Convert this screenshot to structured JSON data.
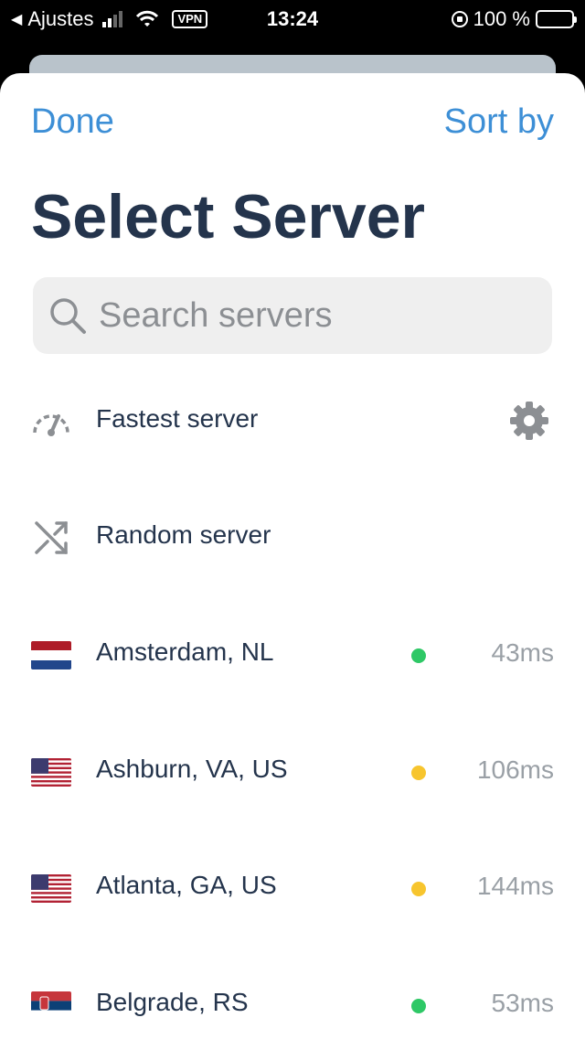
{
  "status_bar": {
    "back_label": "Ajustes",
    "vpn_badge": "VPN",
    "time": "13:24",
    "battery": "100 %"
  },
  "nav": {
    "done_label": "Done",
    "sort_label": "Sort by"
  },
  "title": "Select Server",
  "search": {
    "value": "",
    "placeholder": "Search servers"
  },
  "options": [
    {
      "label": "Fastest server",
      "icon": "speedometer-icon"
    },
    {
      "label": "Random server",
      "icon": "shuffle-icon"
    }
  ],
  "servers": [
    {
      "name": "Amsterdam, NL",
      "latency": "43ms",
      "flag": "NL",
      "status_color": "#2ec866"
    },
    {
      "name": "Ashburn, VA, US",
      "latency": "106ms",
      "flag": "US",
      "status_color": "#f7c52e"
    },
    {
      "name": "Atlanta, GA, US",
      "latency": "144ms",
      "flag": "US",
      "status_color": "#f7c52e"
    },
    {
      "name": "Belgrade, RS",
      "latency": "53ms",
      "flag": "RS",
      "status_color": "#2ec866"
    }
  ],
  "colors": {
    "accent": "#3d8fd6",
    "title": "#24344c",
    "good": "#2ec866",
    "medium": "#f7c52e"
  }
}
